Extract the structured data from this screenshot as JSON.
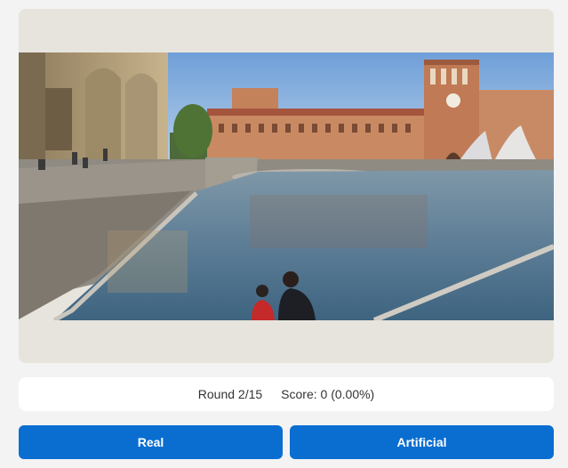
{
  "game": {
    "round_label": "Round 2/15",
    "score_label": "Score: 0 (0.00%)"
  },
  "buttons": {
    "real": "Real",
    "artificial": "Artificial"
  },
  "colors": {
    "button_blue": "#0a6ed1",
    "card_bg": "#e7e4dd",
    "page_bg": "#f3f3f3"
  }
}
